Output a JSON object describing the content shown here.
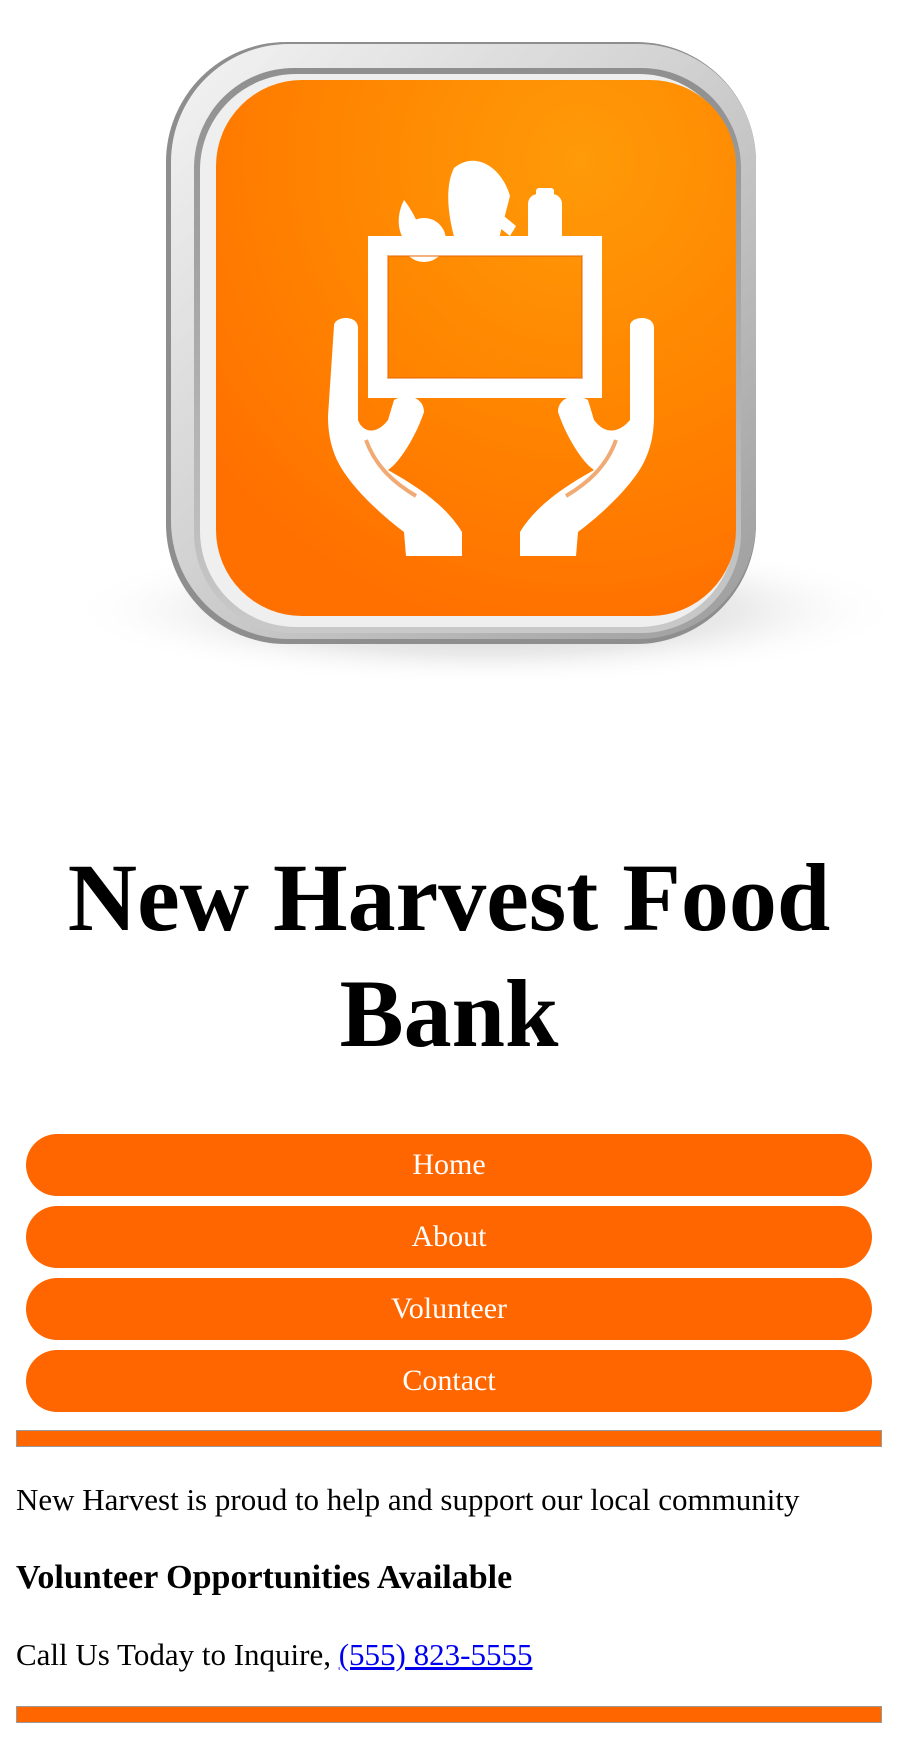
{
  "header": {
    "logo_icon": "food-bank-hands-box-icon",
    "title": "New Harvest Food Bank"
  },
  "nav": {
    "items": [
      {
        "label": "Home"
      },
      {
        "label": "About"
      },
      {
        "label": "Volunteer"
      },
      {
        "label": "Contact"
      }
    ]
  },
  "content": {
    "intro": "New Harvest is proud to help and support our local community",
    "heading": "Volunteer Opportunities Available",
    "call_text": "Call Us Today to Inquire,",
    "phone": "(555) 823-5555"
  },
  "colors": {
    "accent": "#ff6600",
    "logo_orange": "#ff8a00",
    "link": "#0000ee"
  }
}
